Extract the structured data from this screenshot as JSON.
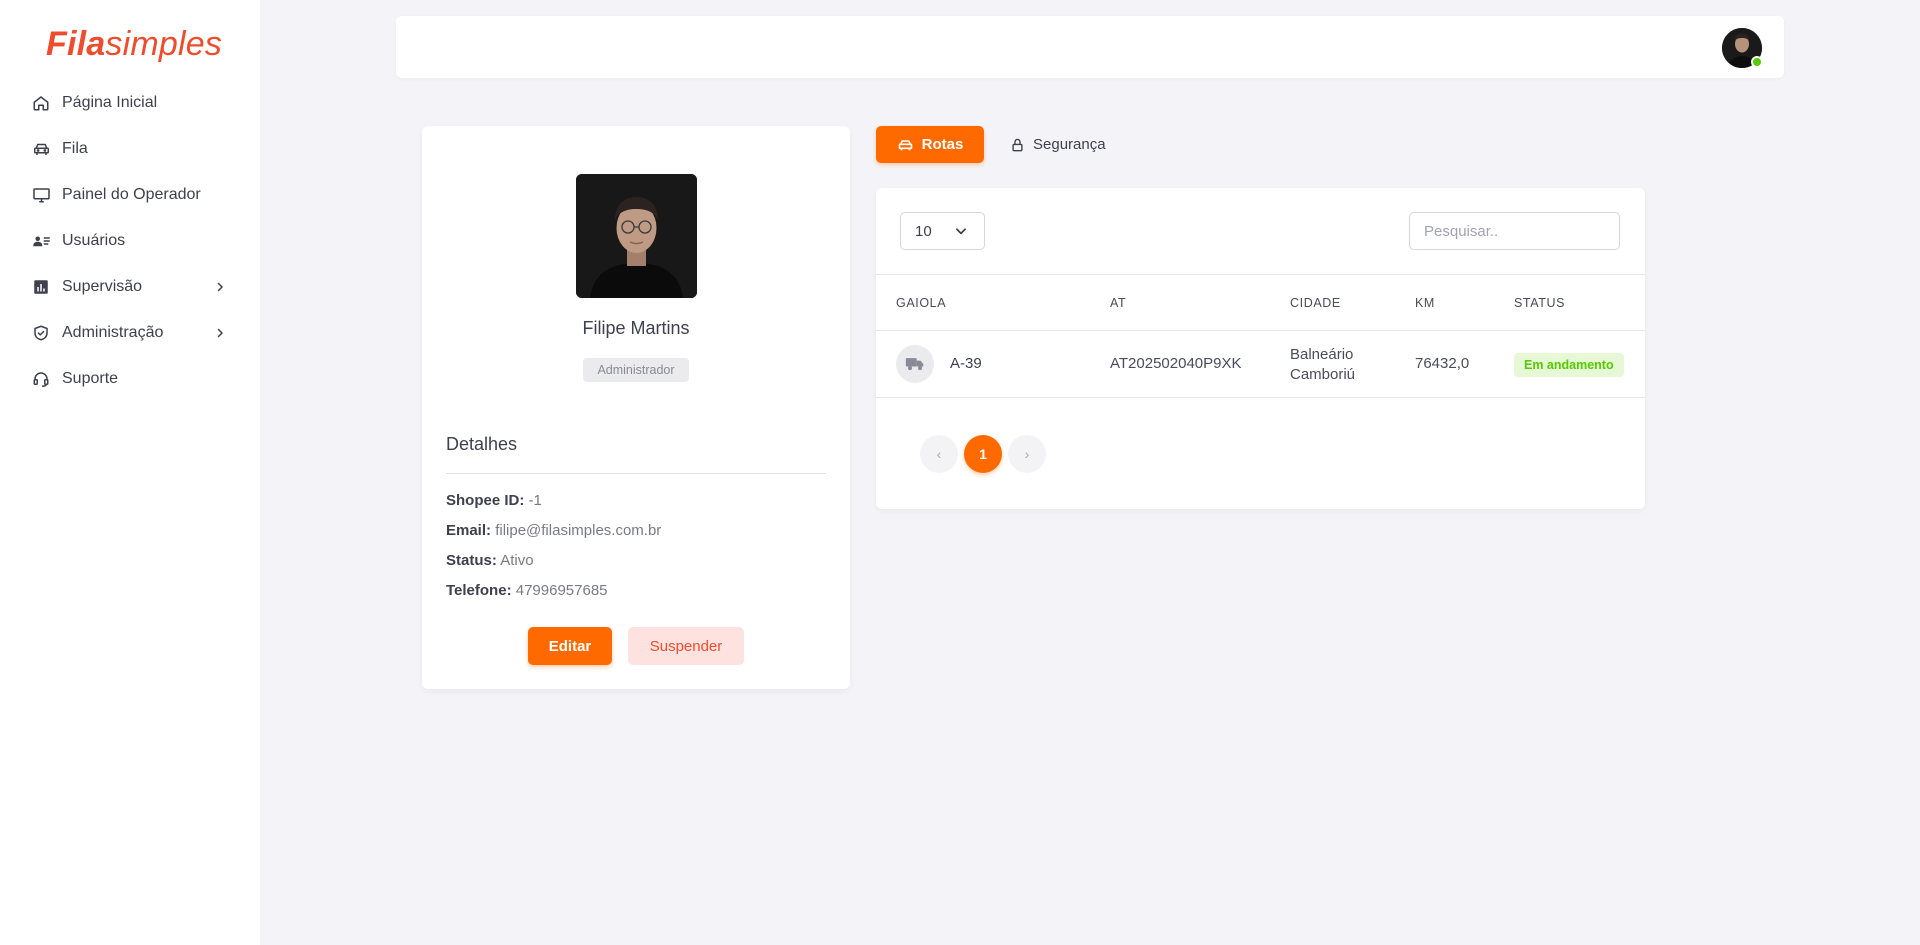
{
  "brand": {
    "part1": "Fila",
    "part2": "simples",
    "color": "#ee4d2d"
  },
  "sidebar": {
    "items": [
      {
        "label": "Página Inicial",
        "icon": "home-icon"
      },
      {
        "label": "Fila",
        "icon": "car-icon"
      },
      {
        "label": "Painel do Operador",
        "icon": "monitor-icon"
      },
      {
        "label": "Usuários",
        "icon": "users-icon"
      },
      {
        "label": "Supervisão",
        "icon": "chart-icon",
        "has_submenu": true
      },
      {
        "label": "Administração",
        "icon": "shield-icon",
        "has_submenu": true
      },
      {
        "label": "Suporte",
        "icon": "headset-icon"
      }
    ]
  },
  "header": {
    "user_status": "online"
  },
  "profile": {
    "name": "Filipe Martins",
    "role": "Administrador",
    "details_title": "Detalhes",
    "details": [
      {
        "key": "Shopee ID:",
        "value": "-1"
      },
      {
        "key": "Email:",
        "value": "filipe@filasimples.com.br"
      },
      {
        "key": "Status:",
        "value": "Ativo"
      },
      {
        "key": "Telefone:",
        "value": "47996957685"
      }
    ],
    "edit_label": "Editar",
    "suspend_label": "Suspender"
  },
  "tabs": [
    {
      "label": "Rotas",
      "icon": "car-icon",
      "active": true
    },
    {
      "label": "Segurança",
      "icon": "lock-icon",
      "active": false
    }
  ],
  "table": {
    "page_size": "10",
    "search_placeholder": "Pesquisar..",
    "columns": [
      "GAIOLA",
      "AT",
      "CIDADE",
      "KM",
      "STATUS"
    ],
    "rows": [
      {
        "gaiola": "A-39",
        "at": "AT202502040P9XK",
        "cidade_line1": "Balneário",
        "cidade_line2": "Camboriú",
        "km": "76432,0",
        "status": "Em andamento"
      }
    ],
    "pagination": {
      "prev": "‹",
      "current": "1",
      "next": "›"
    }
  },
  "colors": {
    "accent": "#ff6a00",
    "danger": "#ee4d2d",
    "success": "#56ca00"
  }
}
